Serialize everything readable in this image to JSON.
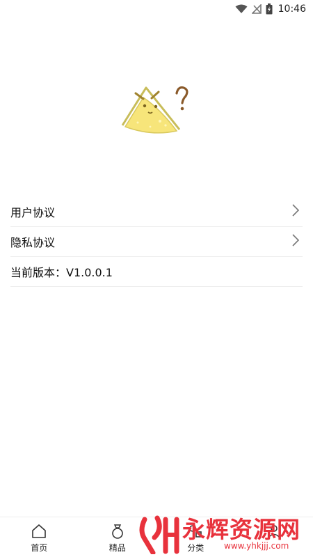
{
  "status_bar": {
    "time": "10:46",
    "icons": [
      "wifi-icon",
      "no-signal-icon",
      "battery-charging-icon"
    ]
  },
  "logo": {
    "icon": "cheese-mascot-icon"
  },
  "menu": {
    "items": [
      {
        "label": "用户协议",
        "icon": "chevron-right-icon"
      },
      {
        "label": "隐私协议",
        "icon": "chevron-right-icon"
      }
    ],
    "version_label": "当前版本：V1.0.0.1"
  },
  "bottom_nav": {
    "items": [
      {
        "label": "首页",
        "icon": "home-icon"
      },
      {
        "label": "精品",
        "icon": "ring-icon"
      },
      {
        "label": "分类",
        "icon": "category-icon"
      },
      {
        "label": "",
        "icon": "mine-icon"
      }
    ]
  },
  "watermark": {
    "text": "永辉资源网",
    "url": "www.yhkjjj.com"
  },
  "colors": {
    "accent": "#e8323c",
    "cheese": "#f7e57a",
    "cheese_outline": "#c8bd5a"
  }
}
